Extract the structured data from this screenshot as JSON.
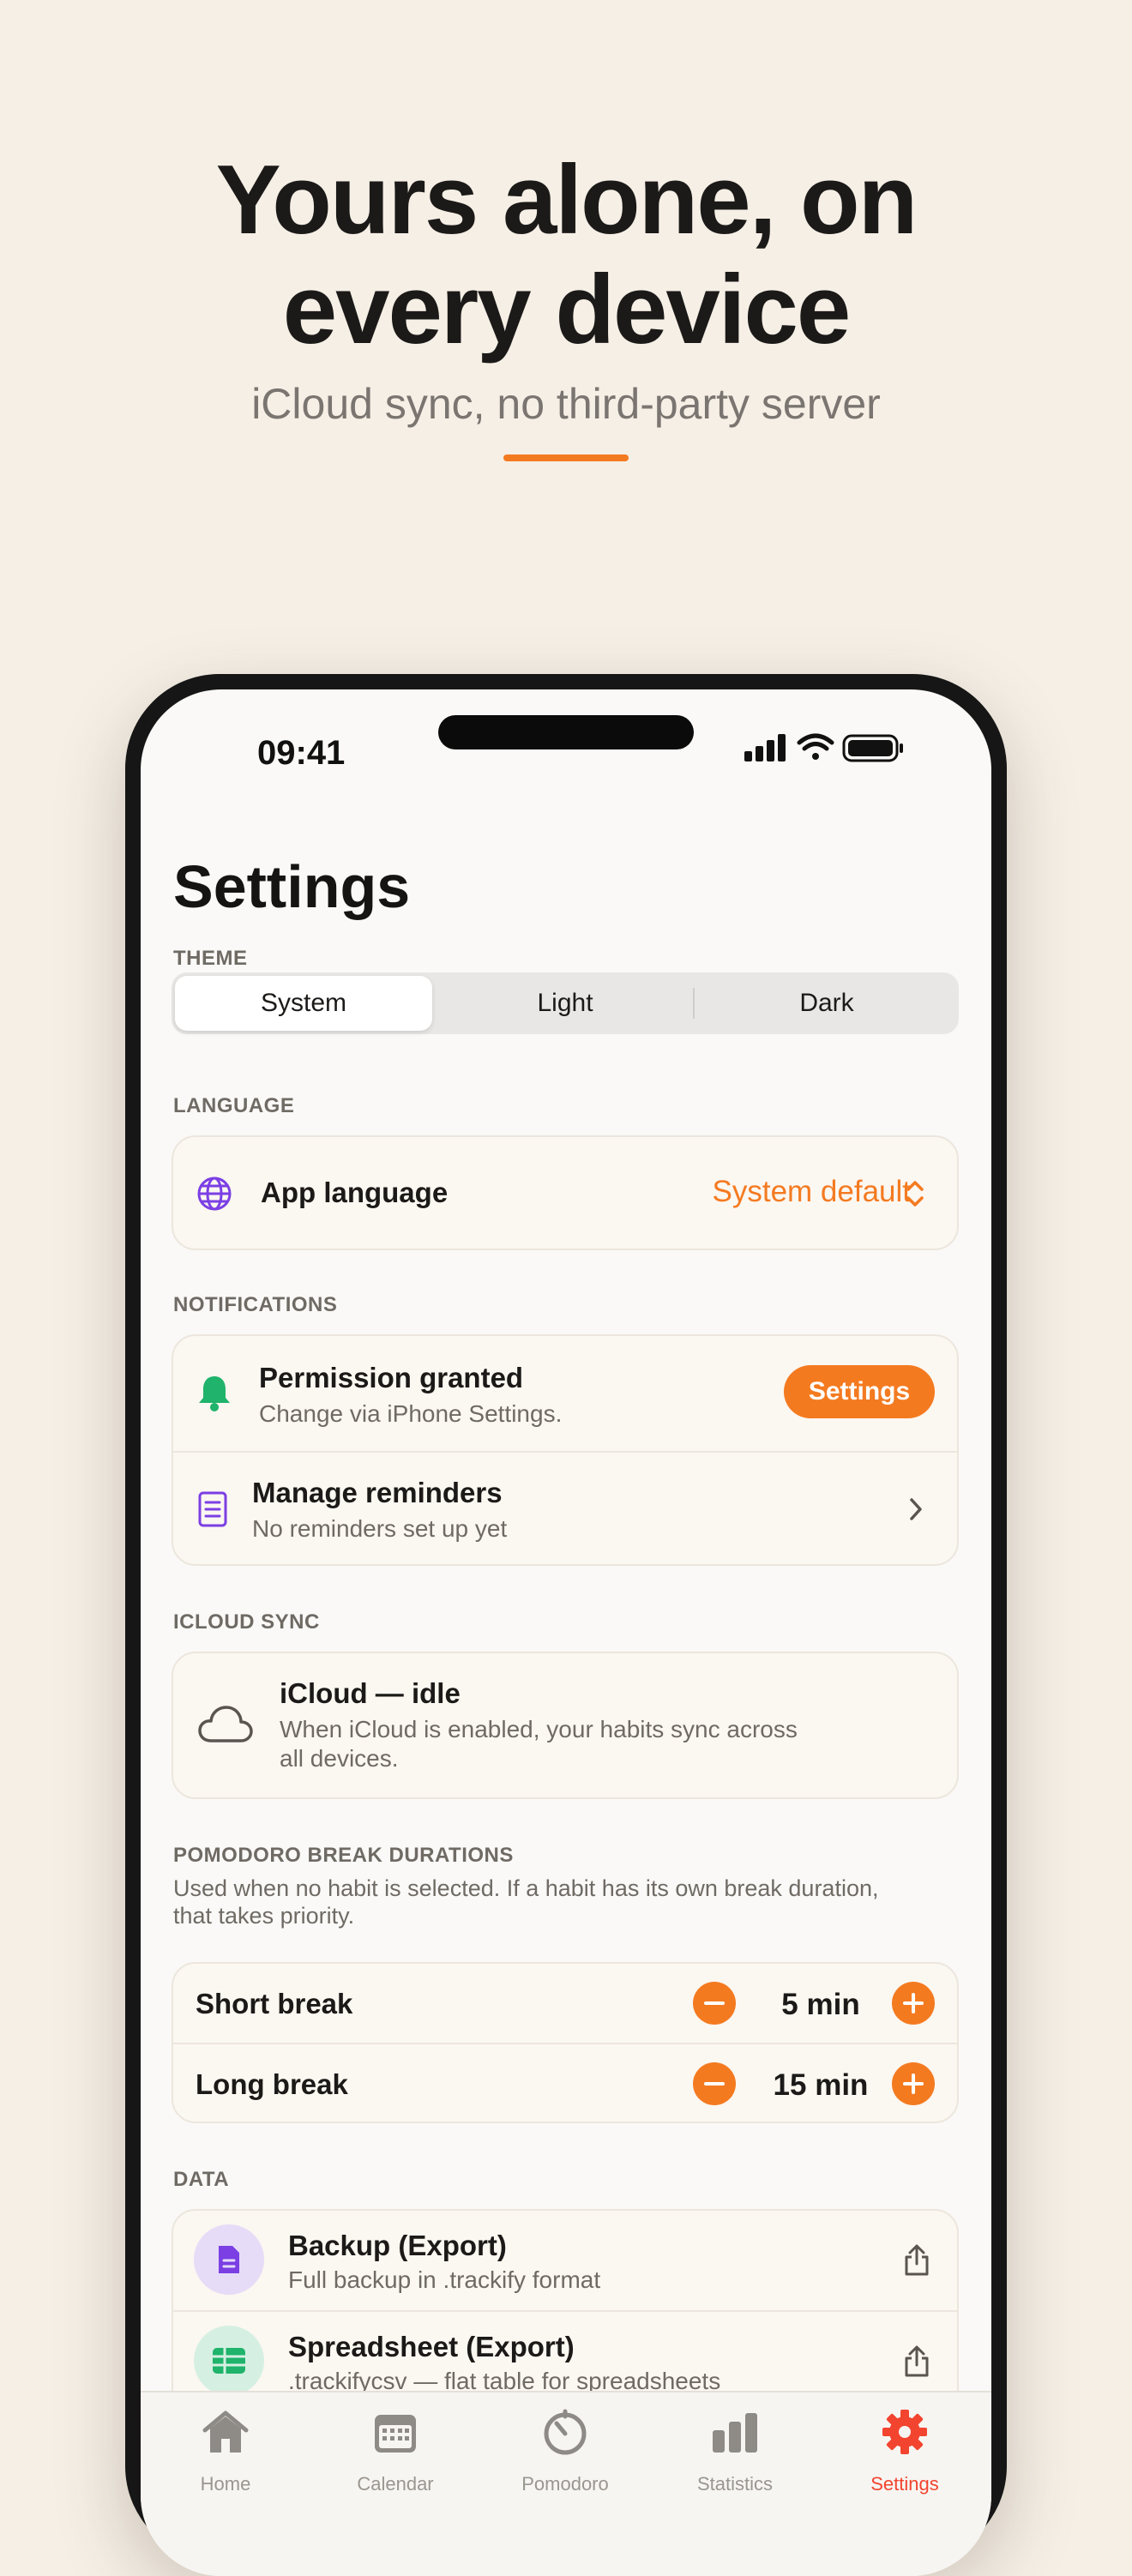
{
  "hero": {
    "title_line1": "Yours alone, on",
    "title_line2": "every device",
    "subtitle": "iCloud sync, no third-party server"
  },
  "status": {
    "time": "09:41"
  },
  "page_title": "Settings",
  "theme": {
    "label": "THEME",
    "options": [
      "System",
      "Light",
      "Dark"
    ],
    "selected": "System"
  },
  "language": {
    "label": "LANGUAGE",
    "row_title": "App language",
    "value": "System default"
  },
  "notifications": {
    "label": "NOTIFICATIONS",
    "permission_title": "Permission granted",
    "permission_sub": "Change via iPhone Settings.",
    "settings_button": "Settings",
    "reminders_title": "Manage reminders",
    "reminders_sub": "No reminders set up yet"
  },
  "icloud": {
    "label": "ICLOUD SYNC",
    "title": "iCloud — idle",
    "desc_line1": "When iCloud is enabled, your habits sync across",
    "desc_line2": "all devices."
  },
  "pomodoro": {
    "label": "POMODORO BREAK DURATIONS",
    "help_line1": "Used when no habit is selected. If a habit has its own break duration,",
    "help_line2": "that takes priority.",
    "short_label": "Short break",
    "short_value": "5 min",
    "long_label": "Long break",
    "long_value": "15 min"
  },
  "data": {
    "label": "DATA",
    "backup_title": "Backup (Export)",
    "backup_sub": "Full backup in .trackify format",
    "sheet_title": "Spreadsheet (Export)",
    "sheet_sub": ".trackifycsv — flat table for spreadsheets"
  },
  "tabs": [
    {
      "label": "Home"
    },
    {
      "label": "Calendar"
    },
    {
      "label": "Pomodoro"
    },
    {
      "label": "Statistics"
    },
    {
      "label": "Settings"
    }
  ],
  "colors": {
    "accent": "#f47a20",
    "active_tab": "#f2442f",
    "bell": "#1fb36b",
    "purple": "#7b3fe4"
  }
}
